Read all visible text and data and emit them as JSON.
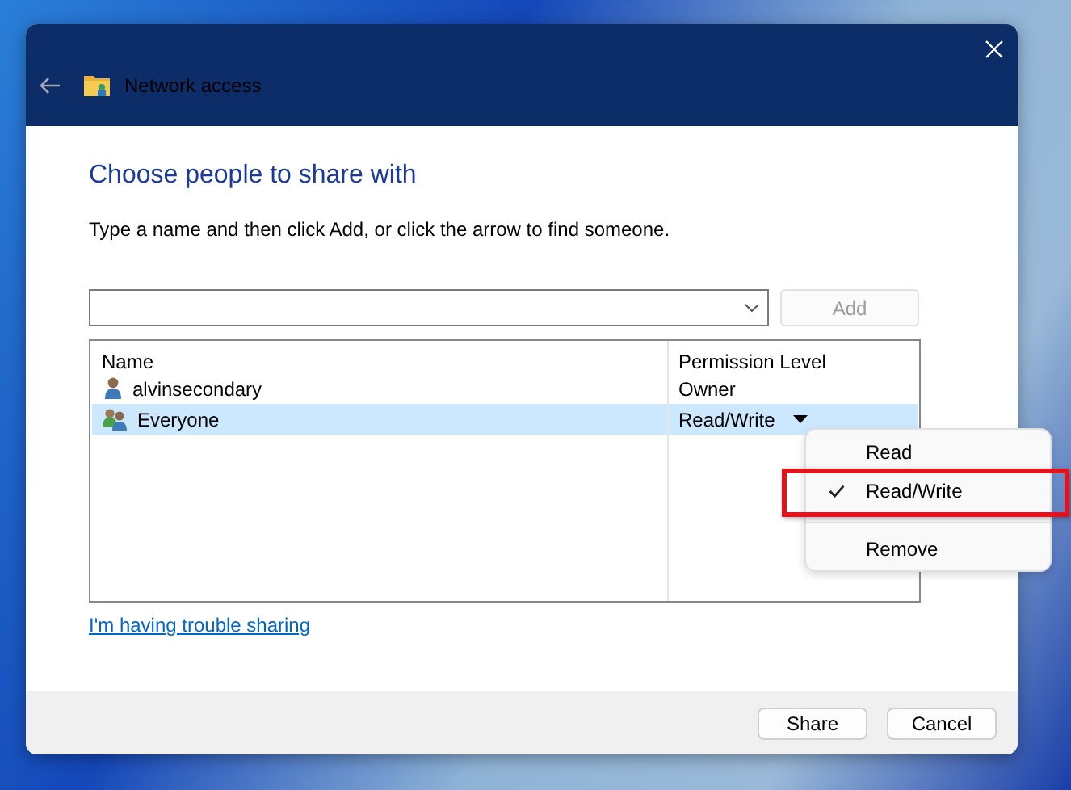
{
  "window": {
    "title": "Network access"
  },
  "heading": "Choose people to share with",
  "instruction": "Type a name and then click Add, or click the arrow to find someone.",
  "add_button": {
    "label": "Add",
    "disabled": true
  },
  "table": {
    "columns": [
      "Name",
      "Permission Level"
    ],
    "rows": [
      {
        "kind": "user",
        "name": "alvinsecondary",
        "permission": "Owner",
        "selected": false,
        "has_menu": false
      },
      {
        "kind": "group",
        "name": "Everyone",
        "permission": "Read/Write",
        "selected": true,
        "has_menu": true
      }
    ]
  },
  "permission_menu": {
    "items": [
      {
        "kind": "option",
        "label": "Read",
        "checked": false,
        "highlighted": false
      },
      {
        "kind": "option",
        "label": "Read/Write",
        "checked": true,
        "highlighted": true
      },
      {
        "kind": "separator"
      },
      {
        "kind": "option",
        "label": "Remove",
        "checked": false,
        "highlighted": false
      }
    ]
  },
  "help_link": "I'm having trouble sharing",
  "buttons": [
    {
      "label": "Share"
    },
    {
      "label": "Cancel"
    }
  ]
}
